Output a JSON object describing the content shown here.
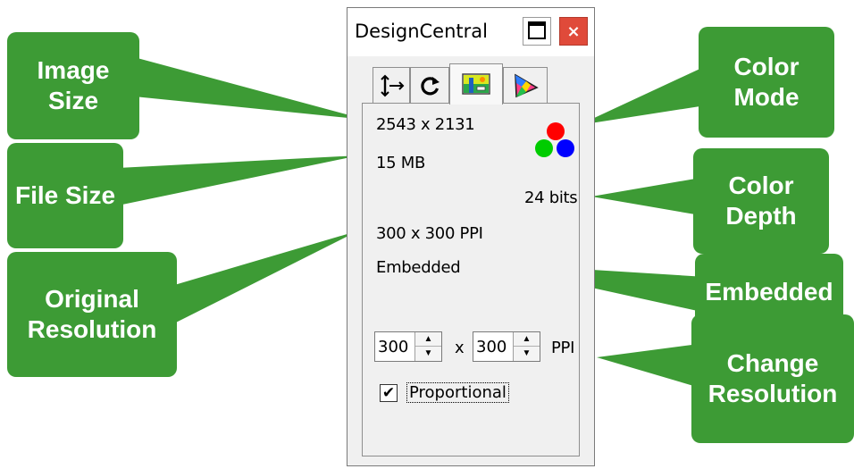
{
  "window": {
    "title": "DesignCentral",
    "close_glyph": "×",
    "tabs": [
      {
        "icon": "dimensions-icon",
        "active": false
      },
      {
        "icon": "rotate-icon",
        "active": false
      },
      {
        "icon": "image-info-icon",
        "active": true
      },
      {
        "icon": "color-triangle-icon",
        "active": false
      }
    ]
  },
  "info": {
    "image_size": "2543 x 2131",
    "file_size": "15 MB",
    "color_depth": "24 bits",
    "resolution": "300 x 300 PPI",
    "resolution_source": "Embedded",
    "color_mode_icon": "rgb-dots-icon"
  },
  "change_resolution": {
    "width_value": "300",
    "times": "x",
    "height_value": "300",
    "unit": "PPI",
    "proportional_label": "Proportional",
    "proportional_checked": true,
    "check_glyph": "✔"
  },
  "callouts": {
    "image_size": "Image\nSize",
    "file_size": "File Size",
    "original_resolution": "Original\nResolution",
    "color_mode": "Color\nMode",
    "color_depth": "Color\nDepth",
    "embedded": "Embedded",
    "change_resolution": "Change\nResolution"
  },
  "colors": {
    "callout_green": "#3d9b35",
    "close_red": "#e04a3a",
    "rgb_red": "#ff0000",
    "rgb_green": "#00cc00",
    "rgb_blue": "#0000ff"
  }
}
